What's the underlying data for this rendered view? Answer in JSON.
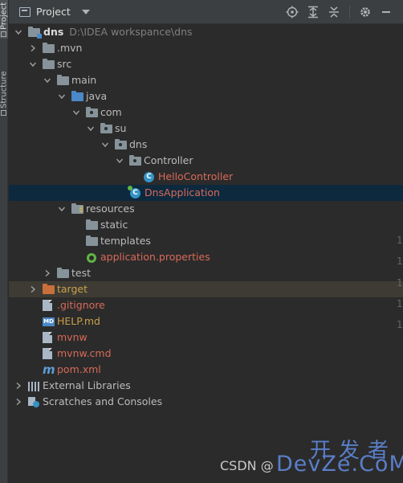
{
  "sidebar_tabs": {
    "project": "Project",
    "structure": "Structure"
  },
  "toolbar": {
    "title": "Project",
    "tools": [
      "locate-icon",
      "expand-all-icon",
      "collapse-all-icon",
      "settings-icon",
      "hide-icon"
    ]
  },
  "tree": {
    "root_name": "dns",
    "root_path": "D:\\IDEA workspance\\dns",
    "mvn": ".mvn",
    "src": "src",
    "main": "main",
    "java": "java",
    "com": "com",
    "su": "su",
    "dns": "dns",
    "controller": "Controller",
    "hello_controller": "HelloController",
    "dns_application": "DnsApplication",
    "resources": "resources",
    "static": "static",
    "templates": "templates",
    "app_props": "application.properties",
    "test": "test",
    "target": "target",
    "gitignore": ".gitignore",
    "help": "HELP.md",
    "mvnw": "mvnw",
    "mvnw_cmd": "mvnw.cmd",
    "pom": "pom.xml",
    "ext_libs": "External Libraries",
    "scratches": "Scratches and Consoles"
  },
  "gutter_digits": [
    "1",
    "1",
    "1",
    "1",
    "1"
  ],
  "colors": {
    "modified_file": "#d86a58",
    "excluded_folder": "#c96f3b",
    "selection": "#0d293e",
    "text": "#bbbbbb"
  },
  "watermark": {
    "csdn": "CSDN @",
    "brand_cn": "开发者",
    "brand_en": "DevZe.CoM"
  }
}
